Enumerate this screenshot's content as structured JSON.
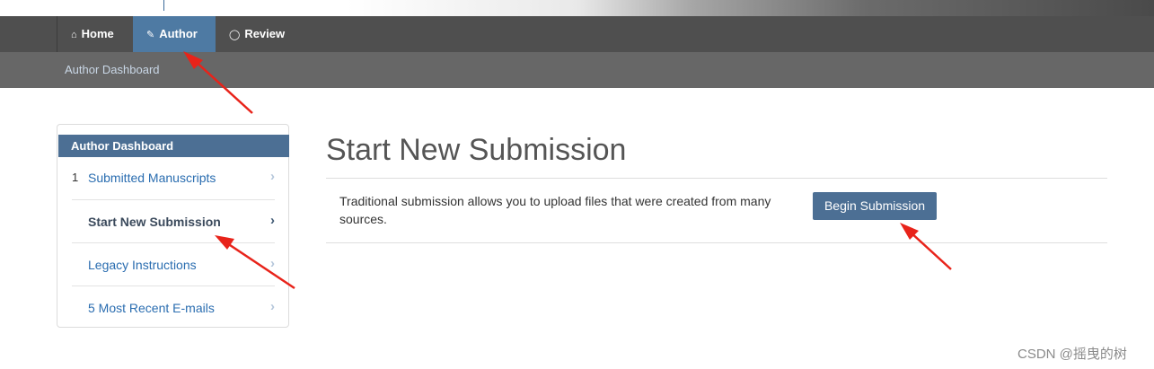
{
  "nav": {
    "items": [
      {
        "label": "Home",
        "icon": "home-icon",
        "active": false
      },
      {
        "label": "Author",
        "icon": "pencil-icon",
        "active": true
      },
      {
        "label": "Review",
        "icon": "speech-bubble-icon",
        "active": false
      }
    ]
  },
  "breadcrumb": {
    "label": "Author Dashboard"
  },
  "sidebar": {
    "title": "Author Dashboard",
    "items": [
      {
        "number": "1",
        "label": "Submitted Manuscripts",
        "active": false
      },
      {
        "number": "",
        "label": "Start New Submission",
        "active": true
      },
      {
        "number": "",
        "label": "Legacy Instructions",
        "active": false
      },
      {
        "number": "",
        "label": "5 Most Recent E-mails",
        "active": false
      }
    ]
  },
  "main": {
    "title": "Start New Submission",
    "description": "Traditional submission allows you to upload files that were created from many sources.",
    "button_label": "Begin Submission"
  },
  "watermark": {
    "text": "CSDN @摇曳的树"
  },
  "colors": {
    "navbar": "#4f4f4f",
    "subbar": "#676767",
    "accent": "#4e7aa3",
    "panel_head": "#4c6f94",
    "link": "#2a6db0",
    "annotation_arrow": "#e8231a"
  }
}
